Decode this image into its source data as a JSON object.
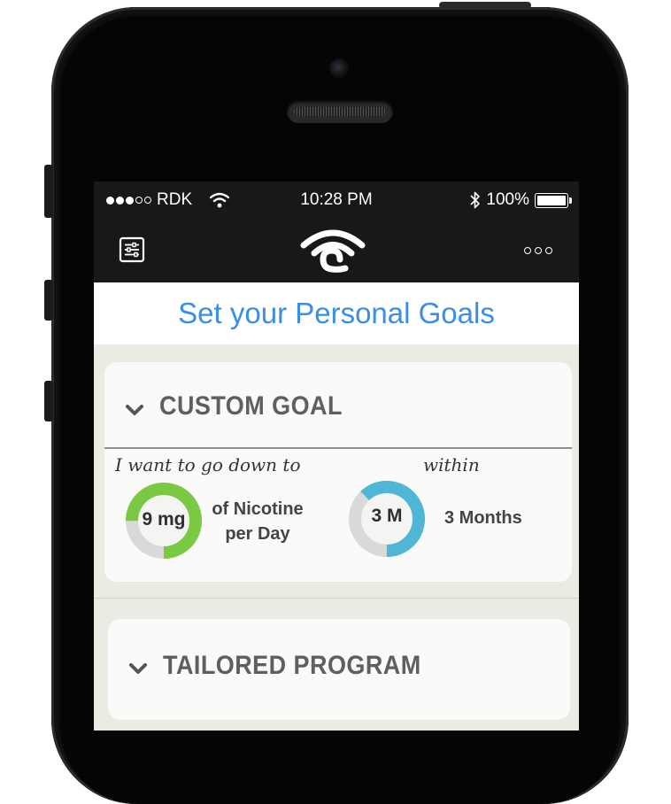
{
  "status_bar": {
    "carrier": "RDK",
    "signal_bars_filled": 3,
    "signal_bars_total": 5,
    "time": "10:28 PM",
    "battery": "100%"
  },
  "nav": {
    "left_icon": "settings-sliders-icon",
    "logo_icon": "app-wifi-logo-icon",
    "right_icon": "more-dots-icon"
  },
  "page": {
    "title": "Set your Personal Goals"
  },
  "custom_goal": {
    "title": "CUSTOM GOAL",
    "intro": "I want to go down to",
    "within": "within",
    "nicotine": {
      "value": "9 mg",
      "label_line1": "of Nicotine",
      "label_line2": "per Day",
      "ring_fraction": 0.75,
      "ring_color": "#7ac943"
    },
    "duration": {
      "value": "3 M",
      "label": "3 Months",
      "ring_fraction": 0.62,
      "ring_color": "#4fb6d6"
    }
  },
  "tailored_program": {
    "title": "TAILORED PROGRAM"
  },
  "colors": {
    "title_blue": "#3a8ee6",
    "bar_dark": "#181818",
    "screen_bg": "#ecebe3",
    "ring_track": "#d9d9d9"
  }
}
